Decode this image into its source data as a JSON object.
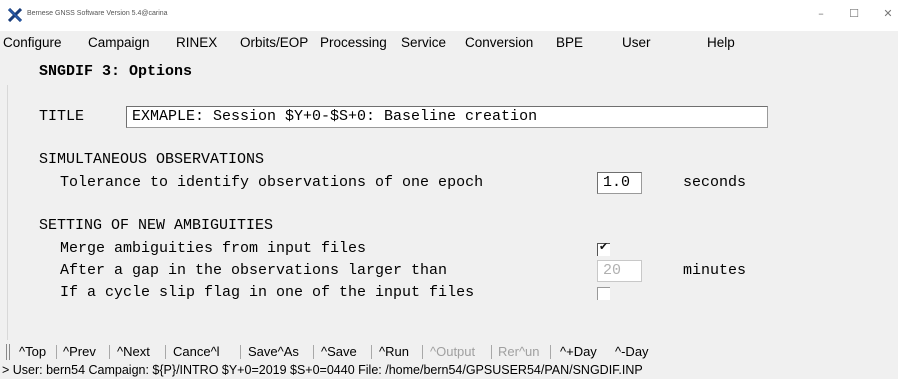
{
  "window": {
    "title": "Bernese GNSS Software Version 5.4@carina",
    "minimize": "–",
    "maximize": "☐",
    "close": "✕"
  },
  "menu": [
    {
      "label": "Configure"
    },
    {
      "label": "Campaign"
    },
    {
      "label": "RINEX"
    },
    {
      "label": "Orbits/EOP"
    },
    {
      "label": "Processing"
    },
    {
      "label": "Service"
    },
    {
      "label": "Conversion"
    },
    {
      "label": "BPE"
    },
    {
      "label": "User"
    },
    {
      "label": "Help"
    }
  ],
  "panel": {
    "title": "SNGDIF 3: Options",
    "title_label": "TITLE",
    "title_value": "EXMAPLE: Session $Y+0-$S+0: Baseline creation",
    "section_sim": "SIMULTANEOUS OBSERVATIONS",
    "tolerance_label": "Tolerance to identify observations of one epoch",
    "tolerance_value": "1.0",
    "tolerance_unit": "seconds",
    "section_amb": "SETTING OF NEW AMBIGUITIES",
    "merge_label": "Merge ambiguities from input files",
    "merge_checked": true,
    "gap_label": "After a gap in the observations larger than",
    "gap_value": "20",
    "gap_unit": "minutes",
    "slip_label": "If a cycle slip flag in one of the input files",
    "slip_checked": false
  },
  "toolbar": [
    {
      "label": "^Top",
      "enabled": true
    },
    {
      "label": "^Prev",
      "enabled": true
    },
    {
      "label": "^Next",
      "enabled": true
    },
    {
      "label": "Cance^l",
      "enabled": true
    },
    {
      "label": "Save^As",
      "enabled": true
    },
    {
      "label": "^Save",
      "enabled": true
    },
    {
      "label": "^Run",
      "enabled": true
    },
    {
      "label": "^Output",
      "enabled": false
    },
    {
      "label": "Rer^un",
      "enabled": false
    },
    {
      "label": "^+Day",
      "enabled": true
    },
    {
      "label": "^-Day",
      "enabled": true
    }
  ],
  "status": "> User: bern54  Campaign: ${P}/INTRO  $Y+0=2019  $S+0=0440  File: /home/bern54/GPSUSER54/PAN/SNGDIF.INP"
}
